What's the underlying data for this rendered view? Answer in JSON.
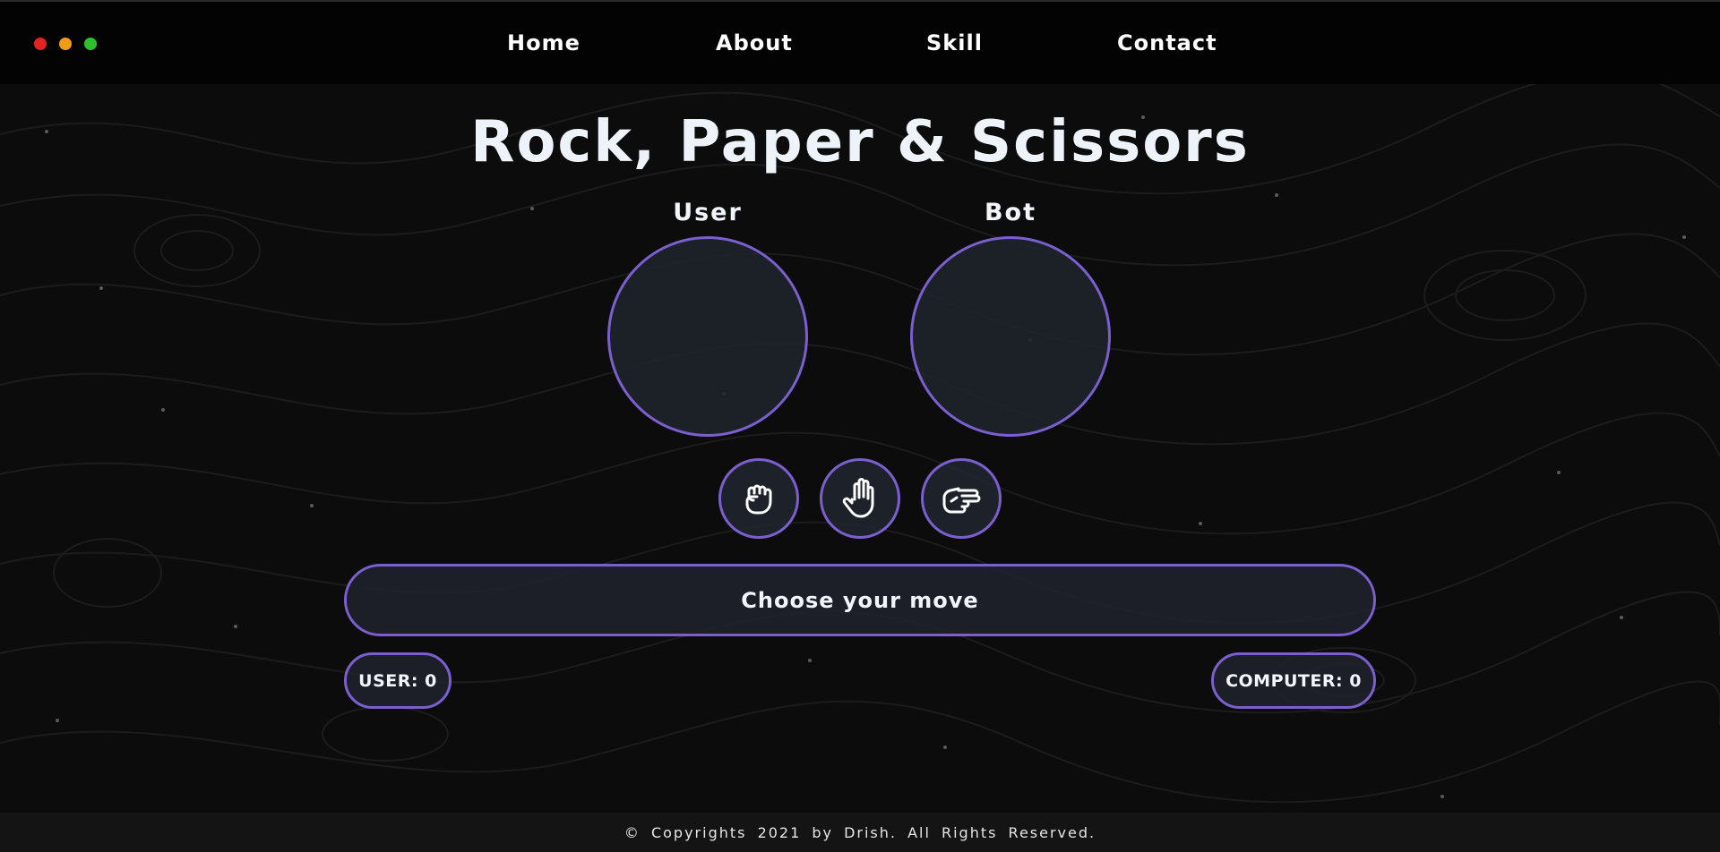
{
  "window": {
    "controls": [
      {
        "name": "close",
        "color": "#e5241f"
      },
      {
        "name": "minimize",
        "color": "#f59a13"
      },
      {
        "name": "maximize",
        "color": "#2dc22b"
      }
    ]
  },
  "nav": {
    "links": [
      "Home",
      "About",
      "Skill",
      "Contact"
    ]
  },
  "game": {
    "title": "Rock, Paper & Scissors",
    "user_label": "User",
    "bot_label": "Bot",
    "moves": [
      {
        "name": "rock",
        "icon": "hand-rock-icon"
      },
      {
        "name": "paper",
        "icon": "hand-paper-icon"
      },
      {
        "name": "scissors",
        "icon": "hand-scissors-icon"
      }
    ],
    "result_message": "Choose your move",
    "user_score": "USER: 0",
    "computer_score": "COMPUTER: 0"
  },
  "footer": {
    "text": "© Copyrights 2021 by Drish. All Rights Reserved."
  },
  "colors": {
    "accent": "#7c5fcf",
    "background": "#0c0c0c",
    "panel": "#1f242c"
  }
}
